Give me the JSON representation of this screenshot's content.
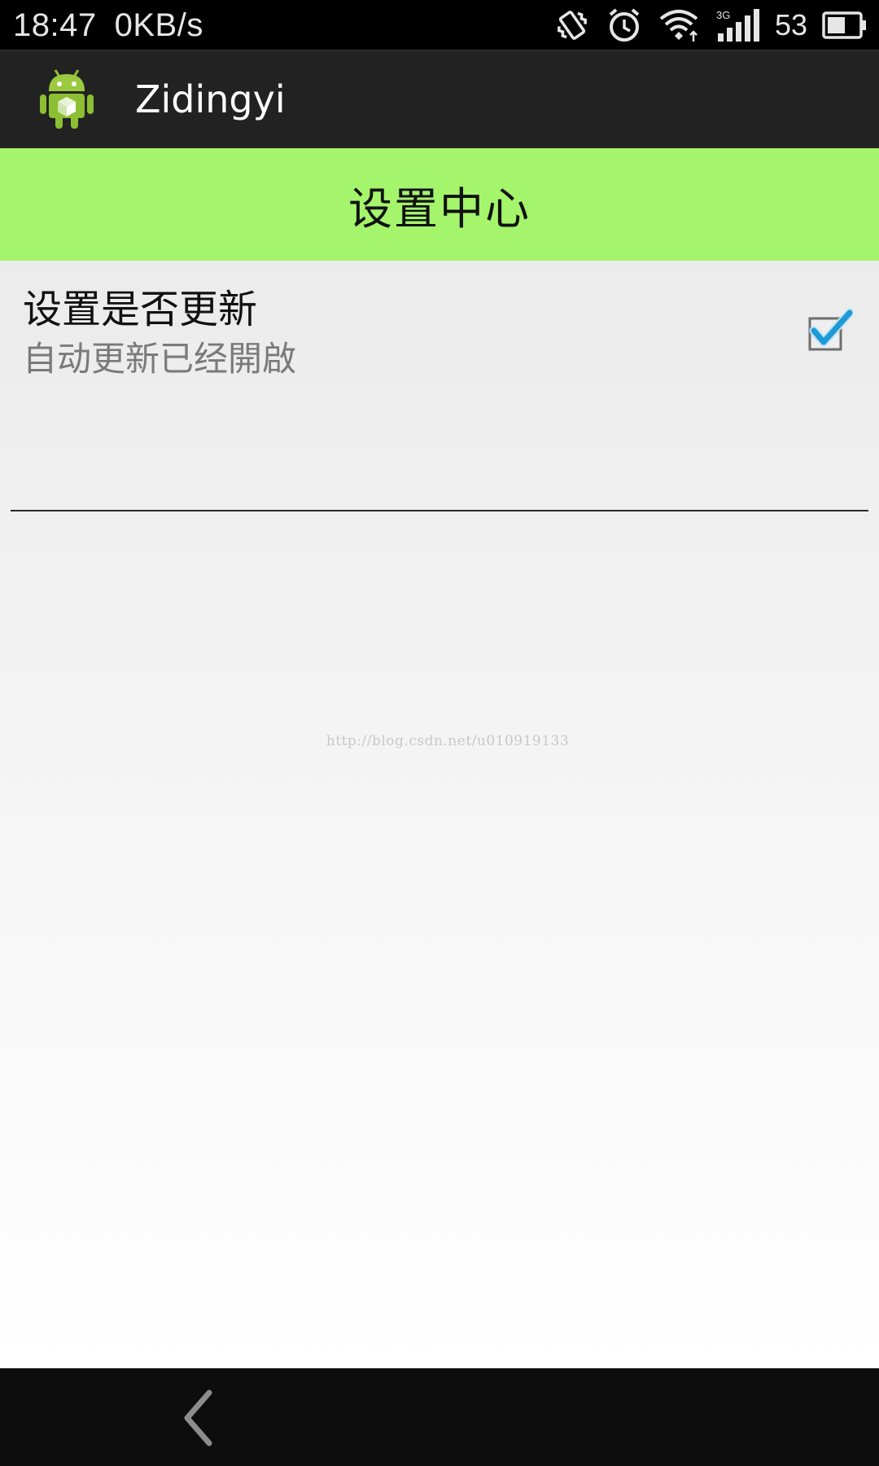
{
  "status_bar": {
    "time": "18:47",
    "net_speed": "0KB/s",
    "icons": [
      "vibrate-icon",
      "alarm-icon",
      "wifi-icon",
      "signal-3g-icon",
      "battery-icon"
    ],
    "network_type": "3G",
    "battery_level": "53"
  },
  "action_bar": {
    "icon": "android-app-icon",
    "title": "Zidingyi"
  },
  "header": {
    "title": "设置中心",
    "color": "#a4f56b"
  },
  "preference": {
    "title": "设置是否更新",
    "summary": "自动更新已经開啟",
    "checked": true,
    "check_color": "#1e9ad6"
  },
  "watermark": "http://blog.csdn.net/u010919133",
  "nav_bar": {
    "back_icon": "back-chevron-icon"
  }
}
